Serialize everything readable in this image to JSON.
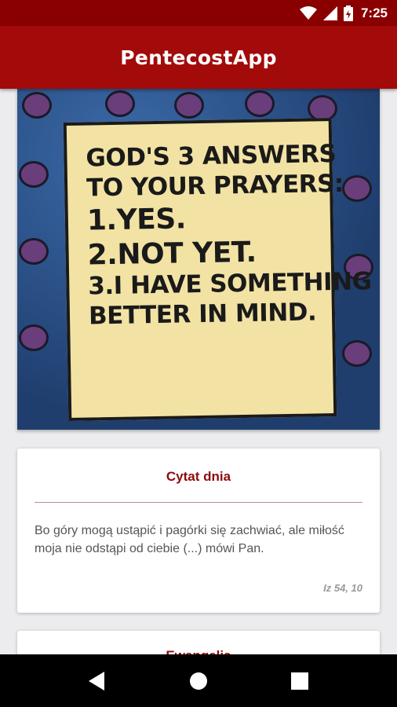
{
  "status_bar": {
    "time": "7:25",
    "icons": [
      "wifi-icon",
      "cell-signal-icon",
      "battery-icon"
    ]
  },
  "app_bar": {
    "title": "PentecostApp",
    "color": "#a30a0a"
  },
  "featured_image": {
    "sign_lines": [
      "GOD'S 3 ANSWERS",
      "TO YOUR PRAYERS:",
      "1.YES.",
      "2.NOT YET.",
      "3.I HAVE SOMETHING",
      "BETTER IN MIND."
    ]
  },
  "quote_card": {
    "title": "Cytat dnia",
    "text": "Bo góry mogą ustąpić i pagórki się zachwiać, ale miłość moja nie odstąpi od ciebie (...) mówi Pan.",
    "reference": "Iz 54, 10"
  },
  "second_card": {
    "title": "Ewangelia"
  },
  "nav_bar": {
    "buttons": [
      "back-icon",
      "home-icon",
      "recents-icon"
    ]
  }
}
